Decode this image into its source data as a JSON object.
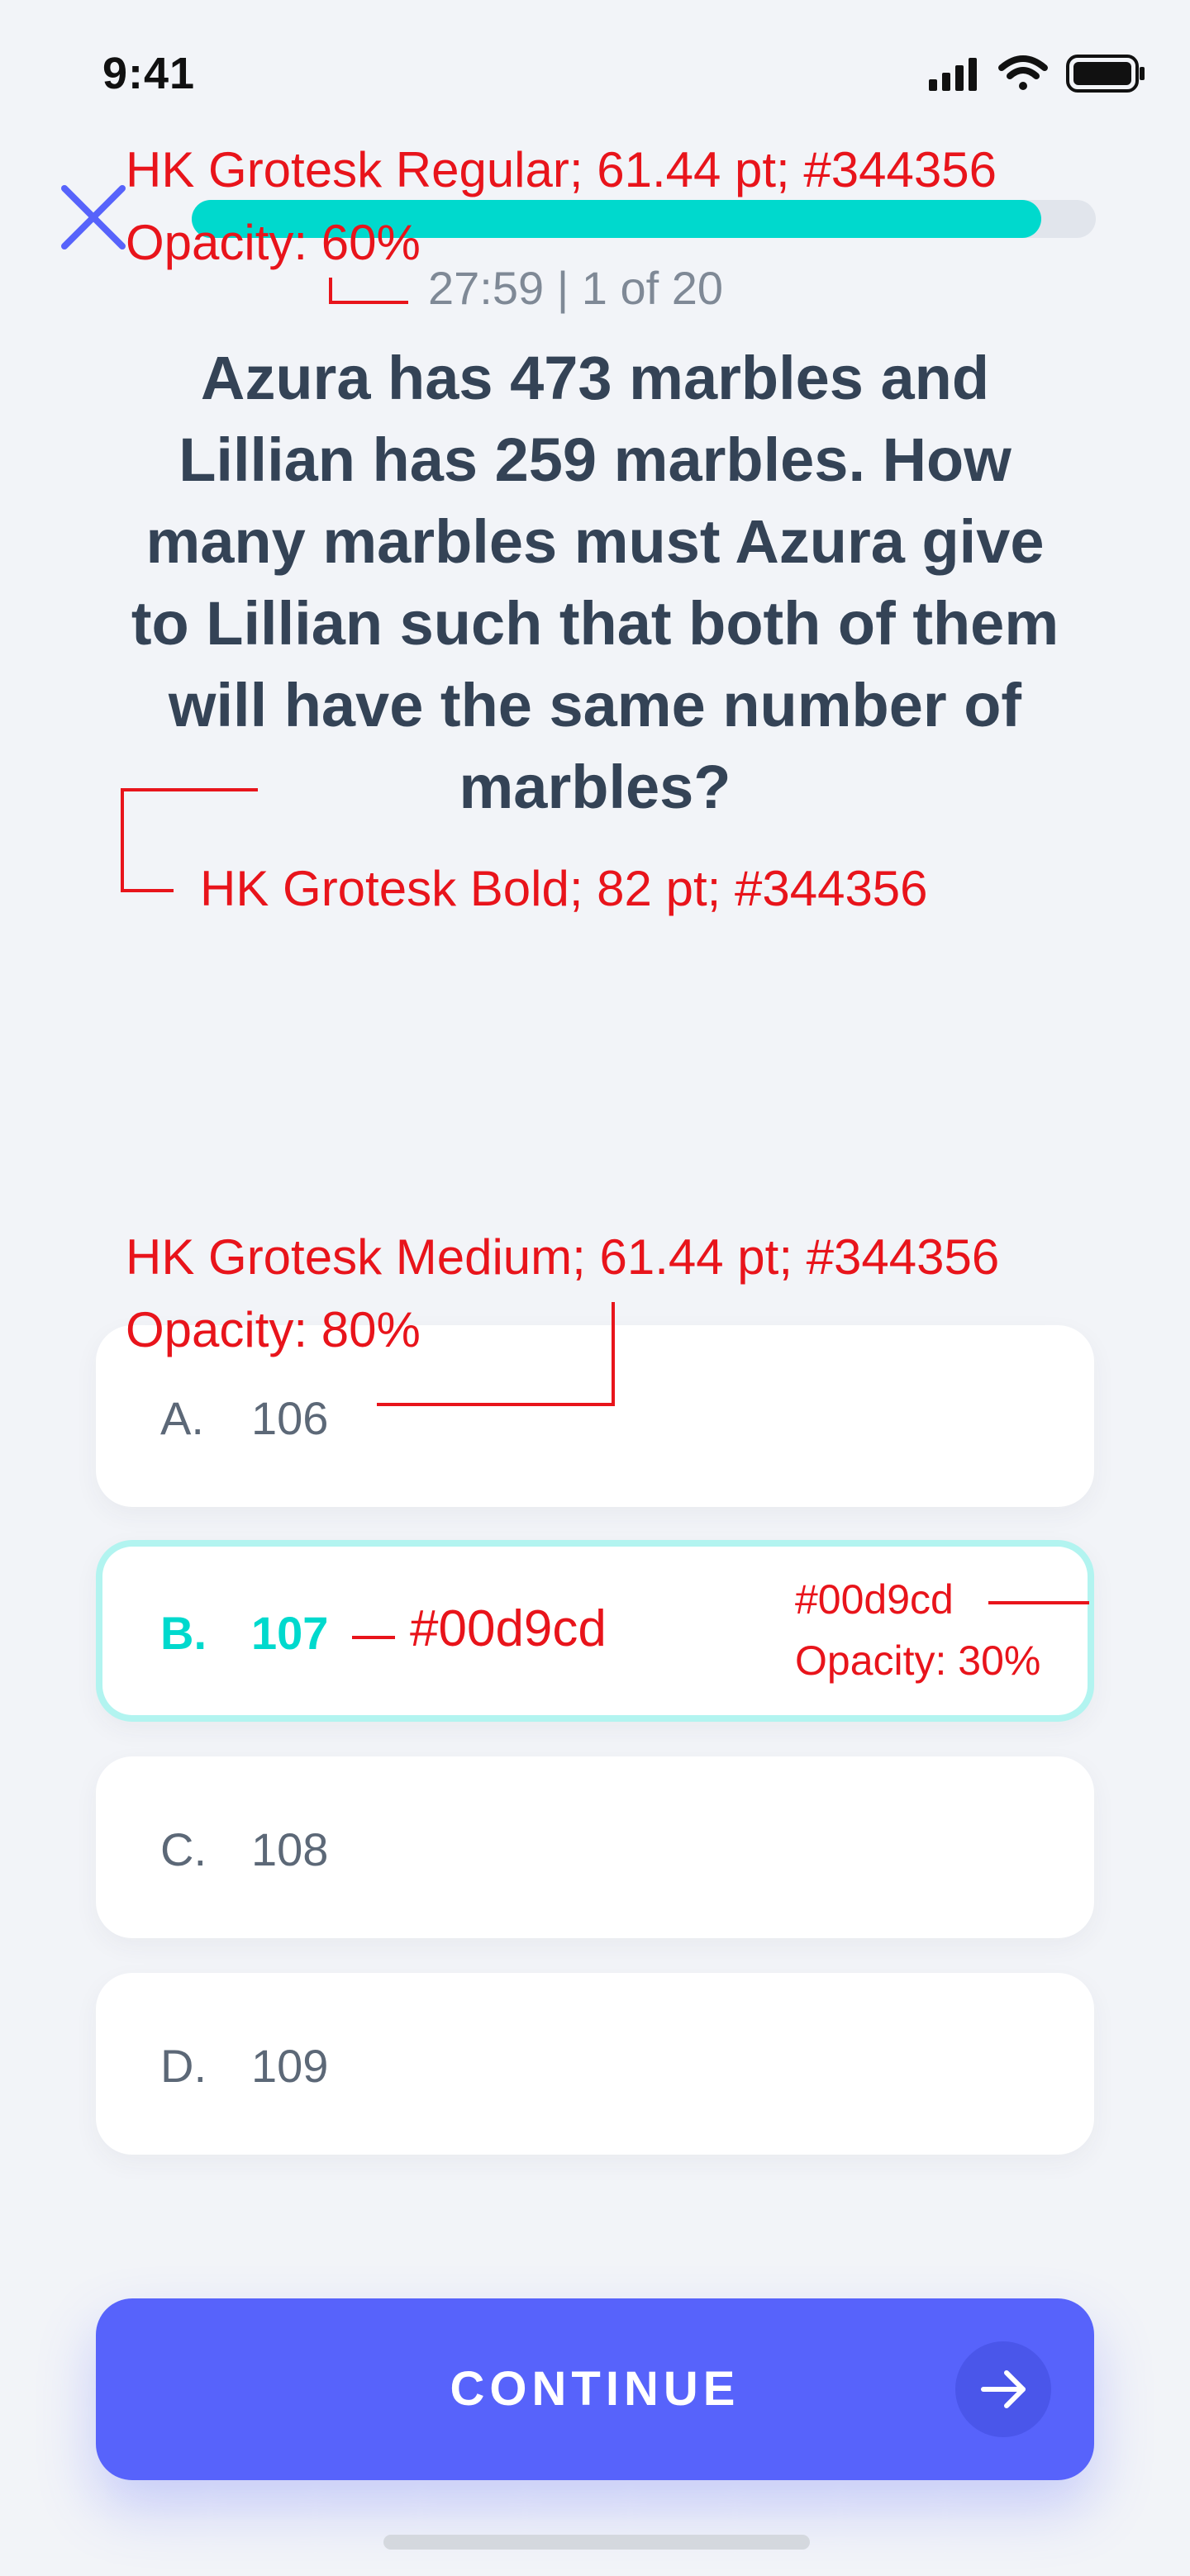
{
  "status_bar": {
    "time": "9:41"
  },
  "header": {
    "progress_fraction": 0.94,
    "timer_text": "27:59 | 1 of 20"
  },
  "question": {
    "text": "Azura has 473 marbles and Lillian has 259 marbles. How many marbles must Azura give to Lillian such that both of them will have the same number of marbles?"
  },
  "options": [
    {
      "letter": "A.",
      "value": "106"
    },
    {
      "letter": "B.",
      "value": "107",
      "selected": true
    },
    {
      "letter": "C.",
      "value": "108"
    },
    {
      "letter": "D.",
      "value": "109"
    }
  ],
  "continue_button": {
    "label": "CONTINUE"
  },
  "annotations": {
    "timer_spec": "HK Grotesk Regular; 61.44 pt; #344356",
    "timer_opacity": "Opacity: 60%",
    "question_spec": "HK Grotesk Bold; 82 pt; #344356",
    "option_spec": "HK Grotesk Medium; 61.44 pt; #344356",
    "option_opacity": "Opacity: 80%",
    "selected_text_color": "#00d9cd",
    "selected_border_color": "#00d9cd",
    "selected_border_opacity": "Opacity: 30%"
  },
  "colors": {
    "background": "#f2f4f8",
    "text": "#344356",
    "accent": "#00d9cd",
    "primary": "#5763fb",
    "close_icon": "#5763fb",
    "annotation": "#e8141b"
  },
  "icons": [
    "close-icon",
    "signal-icon",
    "wifi-icon",
    "battery-icon",
    "arrow-right-icon"
  ]
}
